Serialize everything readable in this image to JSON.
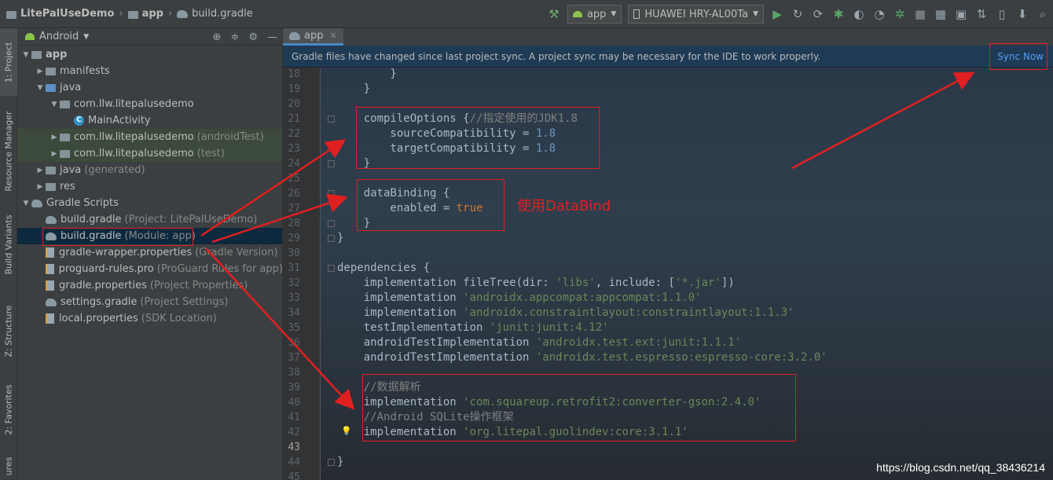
{
  "breadcrumb": {
    "project": "LitePalUseDemo",
    "module": "app",
    "file": "build.gradle"
  },
  "toolbar": {
    "run_config": "app",
    "device": "HUAWEI HRY-AL00Ta",
    "icons": [
      "hammer-icon",
      "run-icon",
      "rerun-icon",
      "debug-icon",
      "profile-icon",
      "attach-icon",
      "stop-icon",
      "sync-icon",
      "avd-icon",
      "sdk-icon",
      "search-icon"
    ]
  },
  "side_tabs": {
    "project": "1: Project",
    "resource_manager": "Resource Manager",
    "build_variants": "Build Variants",
    "structure": "Z: Structure",
    "favorites": "2: Favorites",
    "more": "ures"
  },
  "project_panel": {
    "view_mode": "Android",
    "tree": [
      {
        "label": "app",
        "extra": "",
        "indent": 0,
        "arrow": "▼",
        "icon": "module"
      },
      {
        "label": "manifests",
        "extra": "",
        "indent": 1,
        "arrow": "▶",
        "icon": "folder"
      },
      {
        "label": "java",
        "extra": "",
        "indent": 1,
        "arrow": "▼",
        "icon": "folder-blue"
      },
      {
        "label": "com.llw.litepalusedemo",
        "extra": "",
        "indent": 2,
        "arrow": "▼",
        "icon": "package"
      },
      {
        "label": "MainActivity",
        "extra": "",
        "indent": 3,
        "arrow": "",
        "icon": "class"
      },
      {
        "label": "com.llw.litepalusedemo",
        "extra": "(androidTest)",
        "indent": 2,
        "arrow": "▶",
        "icon": "package"
      },
      {
        "label": "com.llw.litepalusedemo",
        "extra": "(test)",
        "indent": 2,
        "arrow": "▶",
        "icon": "package"
      },
      {
        "label": "java",
        "extra": "(generated)",
        "indent": 1,
        "arrow": "▶",
        "icon": "folder"
      },
      {
        "label": "res",
        "extra": "",
        "indent": 1,
        "arrow": "▶",
        "icon": "folder"
      },
      {
        "label": "Gradle Scripts",
        "extra": "",
        "indent": 0,
        "arrow": "▼",
        "icon": "gradle"
      },
      {
        "label": "build.gradle",
        "extra": "(Project: LitePalUseDemo)",
        "indent": 1,
        "arrow": "",
        "icon": "gradle"
      },
      {
        "label": "build.gradle",
        "extra": "(Module: app)",
        "indent": 1,
        "arrow": "",
        "icon": "gradle"
      },
      {
        "label": "gradle-wrapper.properties",
        "extra": "(Gradle Version)",
        "indent": 1,
        "arrow": "",
        "icon": "props"
      },
      {
        "label": "proguard-rules.pro",
        "extra": "(ProGuard Rules for app)",
        "indent": 1,
        "arrow": "",
        "icon": "props"
      },
      {
        "label": "gradle.properties",
        "extra": "(Project Properties)",
        "indent": 1,
        "arrow": "",
        "icon": "props"
      },
      {
        "label": "settings.gradle",
        "extra": "(Project Settings)",
        "indent": 1,
        "arrow": "",
        "icon": "gradle"
      },
      {
        "label": "local.properties",
        "extra": "(SDK Location)",
        "indent": 1,
        "arrow": "",
        "icon": "props"
      }
    ]
  },
  "editor": {
    "tab": "app",
    "banner": "Gradle files have changed since last project sync. A project sync may be necessary for the IDE to work properly.",
    "sync_now": "Sync Now",
    "annotation": "使用DataBind",
    "lines": [
      {
        "n": "18",
        "tokens": [
          [
            "p",
            "        }"
          ]
        ]
      },
      {
        "n": "19",
        "tokens": [
          [
            "p",
            "    }"
          ]
        ]
      },
      {
        "n": "20",
        "tokens": []
      },
      {
        "n": "21",
        "tokens": [
          [
            "p",
            "    compileOptions {"
          ],
          [
            "c",
            "//指定使用的JDK1.8"
          ]
        ]
      },
      {
        "n": "22",
        "tokens": [
          [
            "p",
            "        sourceCompatibility = "
          ],
          [
            "n",
            "1.8"
          ]
        ]
      },
      {
        "n": "23",
        "tokens": [
          [
            "p",
            "        targetCompatibility = "
          ],
          [
            "n",
            "1.8"
          ]
        ]
      },
      {
        "n": "24",
        "tokens": [
          [
            "p",
            "    }"
          ]
        ]
      },
      {
        "n": "25",
        "tokens": []
      },
      {
        "n": "26",
        "tokens": [
          [
            "p",
            "    dataBinding {"
          ]
        ]
      },
      {
        "n": "27",
        "tokens": [
          [
            "p",
            "        enabled = "
          ],
          [
            "k",
            "true"
          ]
        ]
      },
      {
        "n": "28",
        "tokens": [
          [
            "p",
            "    }"
          ]
        ]
      },
      {
        "n": "29",
        "tokens": [
          [
            "p",
            "}"
          ]
        ]
      },
      {
        "n": "30",
        "tokens": []
      },
      {
        "n": "31",
        "tokens": [
          [
            "p",
            "dependencies {"
          ]
        ]
      },
      {
        "n": "32",
        "tokens": [
          [
            "p",
            "    implementation fileTree(dir: "
          ],
          [
            "s",
            "'libs'"
          ],
          [
            "p",
            ", include: ["
          ],
          [
            "s",
            "'*.jar'"
          ],
          [
            "p",
            "])"
          ]
        ]
      },
      {
        "n": "33",
        "tokens": [
          [
            "p",
            "    implementation "
          ],
          [
            "s",
            "'androidx.appcompat:appcompat:1.1.0'"
          ]
        ]
      },
      {
        "n": "34",
        "tokens": [
          [
            "p",
            "    implementation "
          ],
          [
            "s",
            "'androidx.constraintlayout:constraintlayout:1.1.3'"
          ]
        ]
      },
      {
        "n": "35",
        "tokens": [
          [
            "p",
            "    testImplementation "
          ],
          [
            "s",
            "'junit:junit:4.12'"
          ]
        ]
      },
      {
        "n": "36",
        "tokens": [
          [
            "p",
            "    androidTestImplementation "
          ],
          [
            "s",
            "'androidx.test.ext:junit:1.1.1'"
          ]
        ]
      },
      {
        "n": "37",
        "tokens": [
          [
            "p",
            "    androidTestImplementation "
          ],
          [
            "s",
            "'androidx.test.espresso:espresso-core:3.2.0'"
          ]
        ]
      },
      {
        "n": "38",
        "tokens": []
      },
      {
        "n": "39",
        "tokens": [
          [
            "c",
            "    //数据解析"
          ]
        ]
      },
      {
        "n": "40",
        "tokens": [
          [
            "p",
            "    implementation "
          ],
          [
            "s",
            "'com.squareup.retrofit2:converter-gson:2.4.0'"
          ]
        ]
      },
      {
        "n": "41",
        "tokens": [
          [
            "c",
            "    //Android SQLite操作框架"
          ]
        ]
      },
      {
        "n": "42",
        "tokens": [
          [
            "p",
            "    implementation "
          ],
          [
            "s",
            "'org.litepal.guolindev:core:3.1.1'"
          ]
        ]
      },
      {
        "n": "43",
        "tokens": []
      },
      {
        "n": "44",
        "tokens": [
          [
            "p",
            "}"
          ]
        ]
      },
      {
        "n": "45",
        "tokens": []
      }
    ]
  },
  "watermark": "https://blog.csdn.net/qq_38436214"
}
